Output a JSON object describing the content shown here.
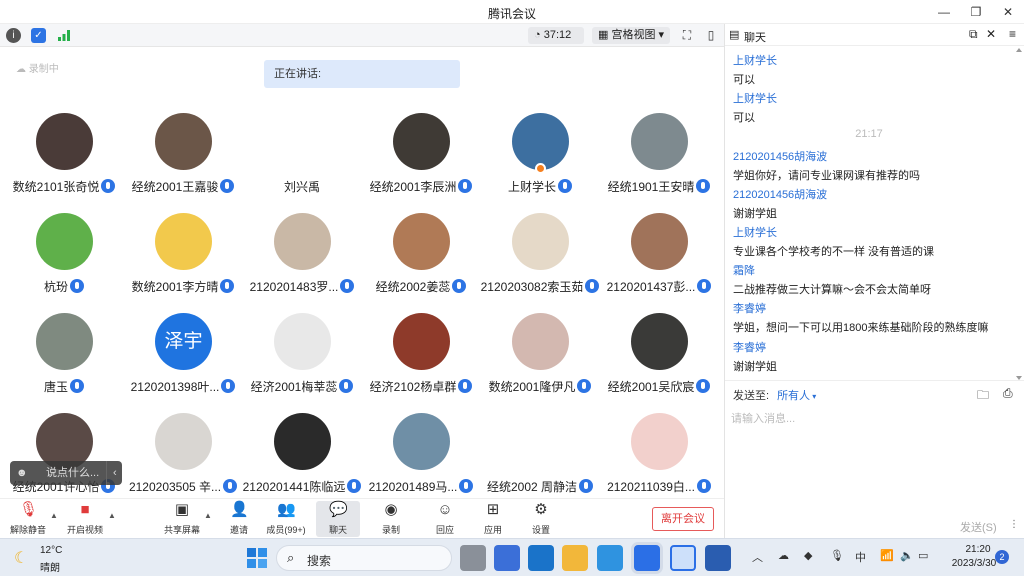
{
  "window": {
    "title": "腾讯会议"
  },
  "infobar": {
    "timer": "37:12",
    "view_mode": "宫格视图"
  },
  "status": {
    "recording": "录制中",
    "speaking": "正在讲话:"
  },
  "participants": [
    {
      "name": "数统2101张奇悦"
    },
    {
      "name": "经统2001王嘉骏"
    },
    {
      "name": "刘兴禹"
    },
    {
      "name": "经统2001李辰洲"
    },
    {
      "name": "上财学长"
    },
    {
      "name": "经统1901王安晴"
    },
    {
      "name": "杭玢"
    },
    {
      "name": "数统2001李方晴"
    },
    {
      "name": "2120201483罗..."
    },
    {
      "name": "经统2002姜蕊"
    },
    {
      "name": "2120203082索玉茹"
    },
    {
      "name": "2120201437彭..."
    },
    {
      "name": "唐玉"
    },
    {
      "name": "2120201398叶..."
    },
    {
      "name": "经济2001梅莘蕊"
    },
    {
      "name": "经济2102杨卓群"
    },
    {
      "name": "数统2001隆伊凡"
    },
    {
      "name": "经统2001吴欣宸"
    },
    {
      "name": "经统2001许心怡"
    },
    {
      "name": "2120203505 辛..."
    },
    {
      "name": "2120201441陈临远"
    },
    {
      "name": "2120201489马..."
    },
    {
      "name": "经统2002 周静洁"
    },
    {
      "name": "2120211039白..."
    }
  ],
  "avatar_texts": {
    "zeyu": "泽宇"
  },
  "reaction": {
    "placeholder": "说点什么..."
  },
  "toolbar": {
    "mute": "解除静音",
    "video": "开启视频",
    "share": "共享屏幕",
    "invite": "邀请",
    "members": "成员(99+)",
    "chat": "聊天",
    "record": "录制",
    "react": "回应",
    "apps": "应用",
    "settings": "设置",
    "leave": "离开会议"
  },
  "chat": {
    "title": "聊天",
    "messages": [
      {
        "kind": "sender",
        "text": "上财学长"
      },
      {
        "kind": "text",
        "text": "可以"
      },
      {
        "kind": "sender",
        "text": "上财学长"
      },
      {
        "kind": "text",
        "text": "可以"
      },
      {
        "kind": "time",
        "text": "21:17"
      },
      {
        "kind": "sender",
        "text": "2120201456胡海波"
      },
      {
        "kind": "text",
        "text": "学姐你好，请问专业课网课有推荐的吗"
      },
      {
        "kind": "sender",
        "text": "2120201456胡海波"
      },
      {
        "kind": "text",
        "text": "谢谢学姐"
      },
      {
        "kind": "sender",
        "text": "上财学长"
      },
      {
        "kind": "text",
        "text": "专业课各个学校考的不一样 没有普适的课"
      },
      {
        "kind": "sender",
        "text": "霜降"
      },
      {
        "kind": "text",
        "text": "二战推荐做三大计算嘛～会不会太简单呀"
      },
      {
        "kind": "sender",
        "text": "李睿婷"
      },
      {
        "kind": "text",
        "text": "学姐，想问一下可以用1800来练基础阶段的熟练度嘛"
      },
      {
        "kind": "sender",
        "text": "李睿婷"
      },
      {
        "kind": "text",
        "text": "谢谢学姐"
      }
    ],
    "send_to_label": "发送至:",
    "send_to_target": "所有人",
    "input_placeholder": "请输入消息...",
    "send_button": "发送(S)"
  },
  "taskbar": {
    "temperature": "12°C",
    "weather": "晴朗",
    "search": "搜索",
    "ime": "中",
    "time": "21:20",
    "date": "2023/3/30",
    "notifications": "2"
  }
}
